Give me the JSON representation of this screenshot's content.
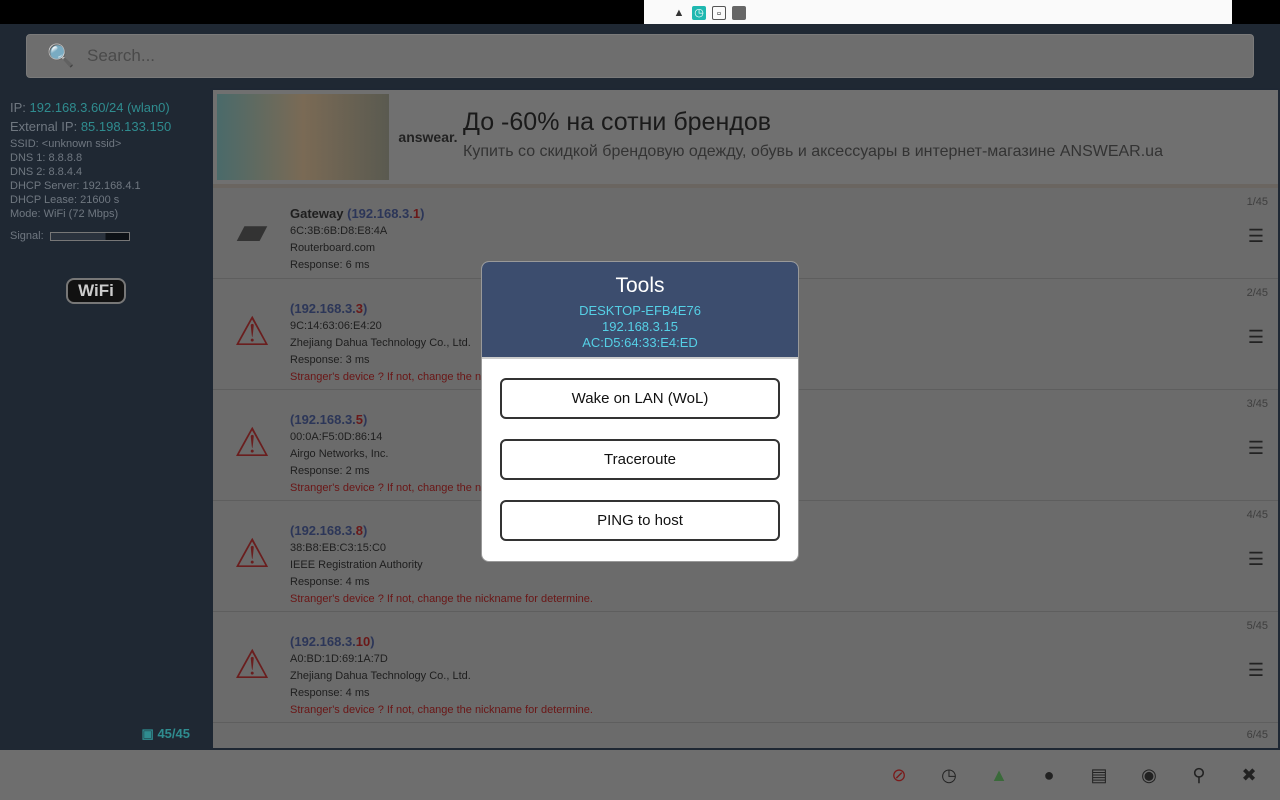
{
  "search": {
    "placeholder": "Search..."
  },
  "network": {
    "ip_label": "IP: ",
    "ip": "192.168.3.60/24 (wlan0)",
    "ext_label": "External IP: ",
    "ext_ip": "85.198.133.150",
    "ssid": "SSID: <unknown ssid>",
    "dns1": "DNS 1: 8.8.8.8",
    "dns2": "DNS 2: 8.8.4.4",
    "dhcp_server": "DHCP Server: 192.168.4.1",
    "dhcp_lease": "DHCP Lease: 21600 s",
    "mode": "Mode: WiFi (72 Mbps)",
    "signal_label": "Signal:",
    "signal_level": 0.7,
    "wifi_logo": "WiFi",
    "count": "45/45"
  },
  "ad": {
    "logo": "answear.",
    "title": "До -60% на сотни брендов",
    "subtitle": "Купить со скидкой брендовую одежду, обувь и аксессуары в интернет-магазине ANSWEAR.ua"
  },
  "devices": [
    {
      "num": "1/45",
      "name": "Gateway ",
      "ip_pre": "192.168.3.",
      "ip_last": "1",
      "mac": "6C:3B:6B:D8:E8:4A",
      "vendor": "Routerboard.com",
      "response": "Response: 6 ms",
      "warn": ""
    },
    {
      "num": "2/45",
      "name": "",
      "ip_pre": "192.168.3.",
      "ip_last": "3",
      "mac": "9C:14:63:06:E4:20",
      "vendor": "Zhejiang Dahua Technology Co., Ltd.",
      "response": "Response: 3 ms",
      "warn": "Stranger's device ? If not, change the nickname for determine."
    },
    {
      "num": "3/45",
      "name": "",
      "ip_pre": "192.168.3.",
      "ip_last": "5",
      "mac": "00:0A:F5:0D:86:14",
      "vendor": "Airgo Networks, Inc.",
      "response": "Response: 2 ms",
      "warn": "Stranger's device ? If not, change the nickname for determine."
    },
    {
      "num": "4/45",
      "name": "",
      "ip_pre": "192.168.3.",
      "ip_last": "8",
      "mac": "38:B8:EB:C3:15:C0",
      "vendor": "IEEE Registration Authority",
      "response": "Response: 4 ms",
      "warn": "Stranger's device ? If not, change the nickname for determine."
    },
    {
      "num": "5/45",
      "name": "",
      "ip_pre": "192.168.3.",
      "ip_last": "10",
      "mac": "A0:BD:1D:69:1A:7D",
      "vendor": "Zhejiang Dahua Technology Co., Ltd.",
      "response": "Response: 4 ms",
      "warn": "Stranger's device ? If not, change the nickname for determine."
    }
  ],
  "next_num": "6/45",
  "dialog": {
    "title": "Tools",
    "host": "DESKTOP-EFB4E76",
    "ip": "192.168.3.15",
    "mac": "AC:D5:64:33:E4:ED",
    "buttons": [
      "Wake on LAN (WoL)",
      "Traceroute",
      "PING to host"
    ]
  },
  "toolbar": [
    "no-ads-icon",
    "timer-icon",
    "drive-icon",
    "globe-icon",
    "calendar-icon",
    "share-icon",
    "search-icon",
    "tools-icon"
  ]
}
